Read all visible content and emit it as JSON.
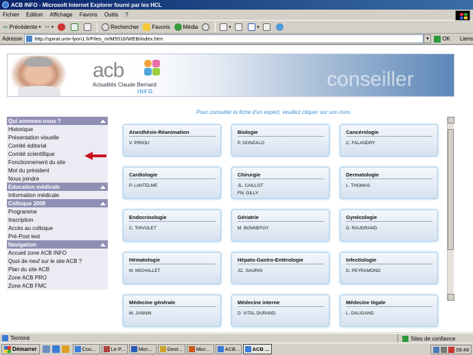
{
  "window": {
    "title": "ACB INFO - Microsoft Internet Explorer fourni par les HCL"
  },
  "menu": [
    "Fichier",
    "Edition",
    "Affichage",
    "Favoris",
    "Outils",
    "?"
  ],
  "toolbar": {
    "back": "Précédente",
    "search": "Rechercher",
    "favorites": "Favoris",
    "media": "Média"
  },
  "address": {
    "label": "Adresse",
    "url": "http://spiral.univ-lyon1.fr/Files_m/M5516/WEB/index.htm",
    "go": "OK",
    "links": "Liens"
  },
  "banner": {
    "logo": "acb",
    "subtitle": "Actualités Claude Bernard",
    "info": "INFO",
    "section": "conseiller"
  },
  "sidebar": {
    "sections": [
      {
        "title": "Qui sommes-nous ?",
        "items": [
          "Historique",
          "Présentation visuelle",
          "Comité éditorial",
          "Comité scientifique",
          "Fonctionnement du site",
          "Mot du président",
          "Nous joindre"
        ]
      },
      {
        "title": "Education médicale",
        "items": [
          "Information médicale"
        ]
      },
      {
        "title": "Colloque 2008",
        "items": [
          "Programme",
          "Inscription",
          "Accès au colloque",
          "Pré-Post test"
        ]
      },
      {
        "title": "Navigation",
        "items": [
          "Accueil zone ACB INFO",
          "Quoi de neuf sur le site ACB ?",
          "Plan du site ACB",
          "Zone ACB PRO",
          "Zone ACB FMC"
        ]
      }
    ]
  },
  "main": {
    "instruction": "Pour consulter la fiche d'un expert, veuillez cliquer sur son nom.",
    "cards": [
      {
        "title": "Anesthésie-Réanimation",
        "names": [
          "V. PIRIOU"
        ]
      },
      {
        "title": "Biologie",
        "names": [
          "P. GONZALO"
        ]
      },
      {
        "title": "Cancérologie",
        "names": [
          "C. FALANDRY"
        ]
      },
      {
        "title": "Cardiologie",
        "names": [
          "P. LANTELME"
        ]
      },
      {
        "title": "Chirurgie",
        "names": [
          "JL. CAILLOT",
          "FN. GILLY"
        ]
      },
      {
        "title": "Dermatologie",
        "names": [
          "L. THOMAS"
        ]
      },
      {
        "title": "Endocrinologie",
        "names": [
          "C. THIVOLET"
        ]
      },
      {
        "title": "Gériatrie",
        "names": [
          "M. BONNEFOY"
        ]
      },
      {
        "title": "Gynécologie",
        "names": [
          "D. RAUDRAND"
        ]
      },
      {
        "title": "Hématologie",
        "names": [
          "M. MICHALLET"
        ]
      },
      {
        "title": "Hépato-Gastro-Entérologie",
        "names": [
          "JC. SAURIN"
        ]
      },
      {
        "title": "Infectiologie",
        "names": [
          "D. PEYRAMOND"
        ]
      },
      {
        "title": "Médecine générale",
        "names": [
          "M. JANNIN"
        ]
      },
      {
        "title": "Médecine interne",
        "names": [
          "D. VITAL DURAND"
        ]
      },
      {
        "title": "Médecine légale",
        "names": [
          "L. DALIGAND"
        ]
      }
    ]
  },
  "status": {
    "text": "Terminé",
    "zone": "Sites de confiance"
  },
  "taskbar": {
    "start": "Démarrer",
    "tasks": [
      {
        "label": "Cou...",
        "color": "#3a7bd5"
      },
      {
        "label": "Le P...",
        "color": "#b04040"
      },
      {
        "label": "Micr...",
        "color": "#2a5bb8"
      },
      {
        "label": "Gest...",
        "color": "#c9a227"
      },
      {
        "label": "Micr...",
        "color": "#c85a1a"
      },
      {
        "label": "ACB...",
        "color": "#3a7bd5"
      },
      {
        "label": "ACB ...",
        "color": "#3a7bd5",
        "active": true
      }
    ],
    "clock": "09:49"
  }
}
